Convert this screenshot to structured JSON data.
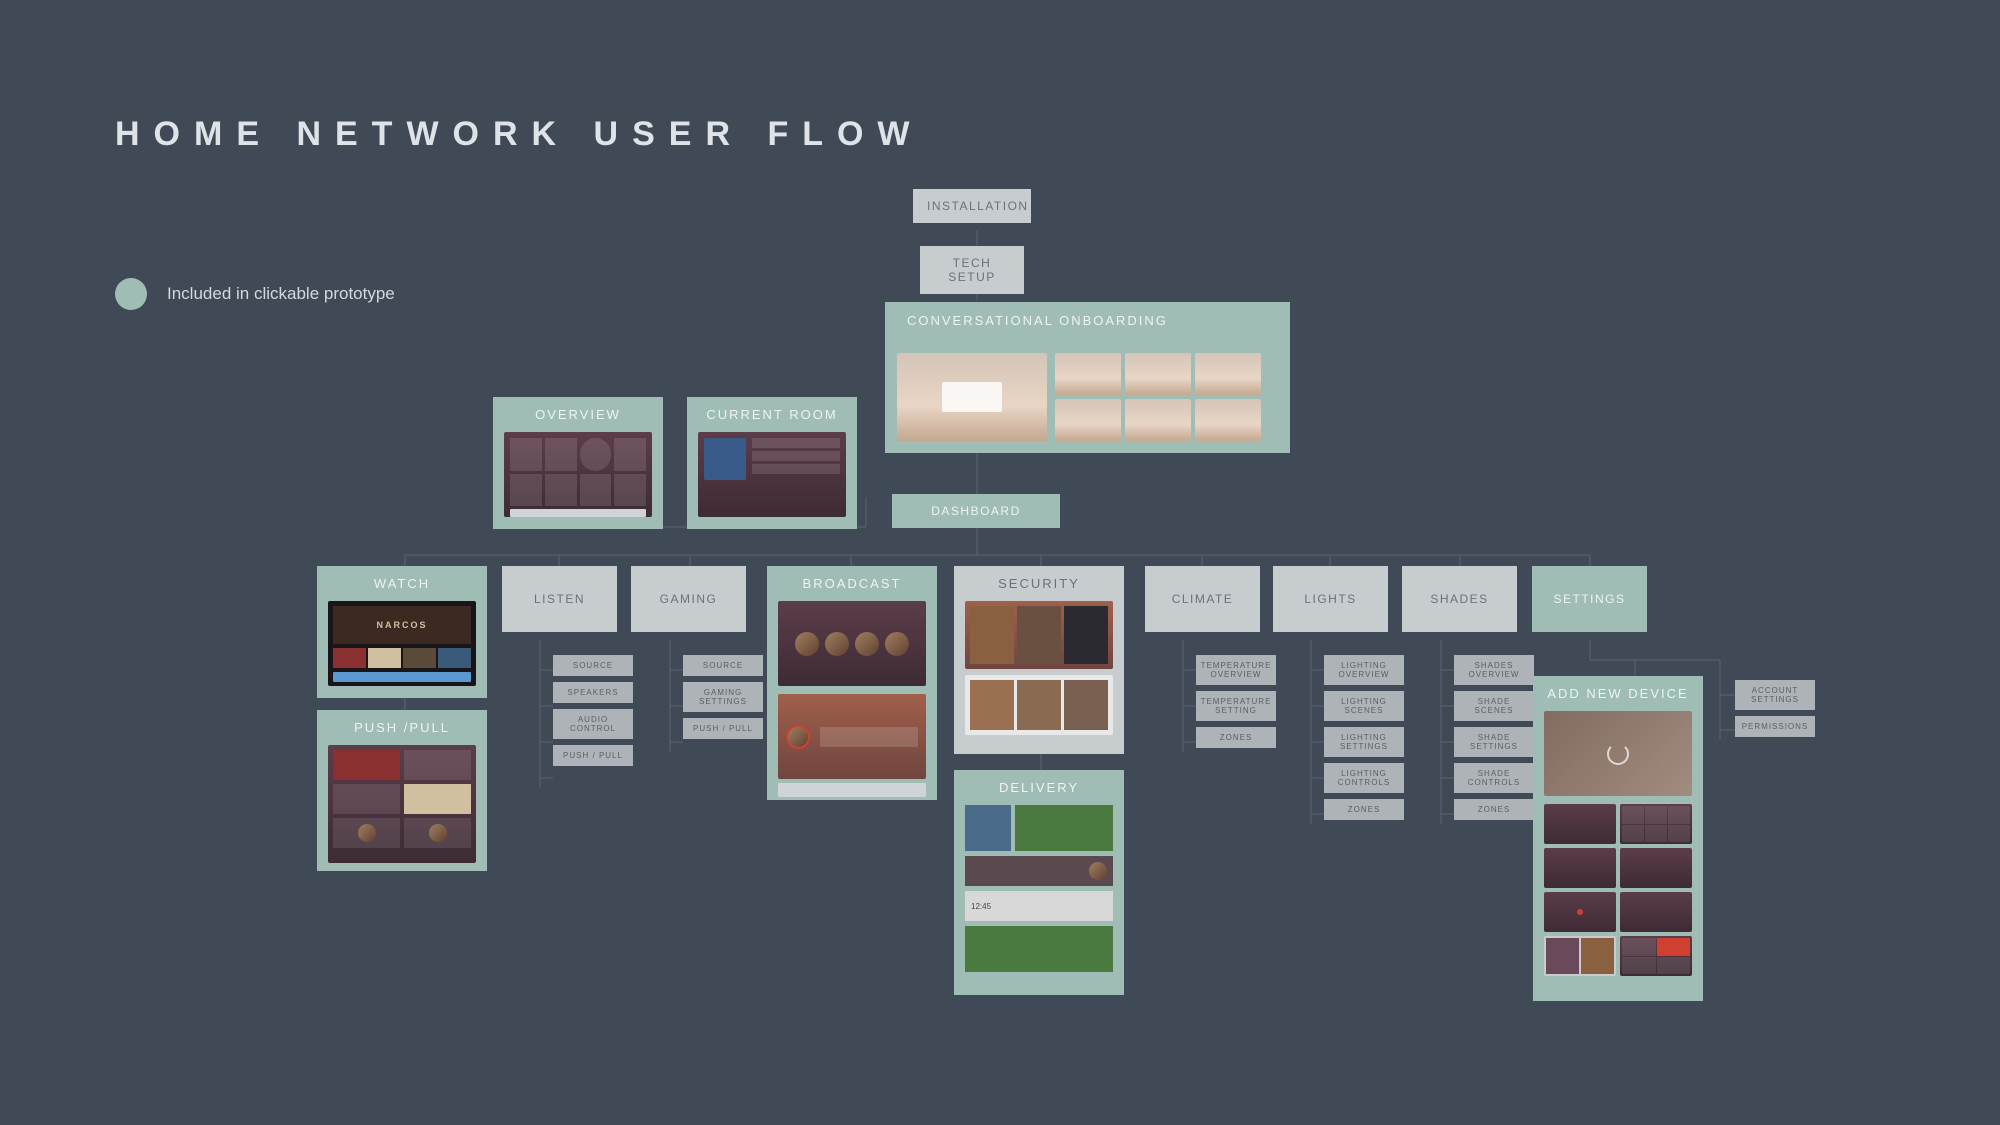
{
  "title": "HOME NETWORK USER FLOW",
  "legend": {
    "label": "Included in clickable prototype"
  },
  "nodes": {
    "installation": "INSTALLATION",
    "tech_setup": "TECH SETUP",
    "conversational": "CONVERSATIONAL ONBOARDING",
    "overview": "OVERVIEW",
    "current_room": "CURRENT ROOM",
    "dashboard": "DASHBOARD",
    "watch": "WATCH",
    "push_pull": "PUSH /PULL",
    "listen": "LISTEN",
    "gaming": "GAMING",
    "broadcast": "BROADCAST",
    "security": "SECURITY",
    "delivery": "DELIVERY",
    "climate": "CLIMATE",
    "lights": "LIGHTS",
    "shades": "SHADES",
    "settings": "SETTINGS",
    "add_new_device": "ADD NEW DEVICE"
  },
  "sub": {
    "listen": [
      "SOURCE",
      "SPEAKERS",
      "AUDIO CONTROL",
      "PUSH / PULL"
    ],
    "gaming": [
      "SOURCE",
      "GAMING SETTINGS",
      "PUSH / PULL"
    ],
    "climate": [
      "TEMPERATURE OVERVIEW",
      "TEMPERATURE SETTING",
      "ZONES"
    ],
    "lights": [
      "LIGHTING OVERVIEW",
      "LIGHTING SCENES",
      "LIGHTING SETTINGS",
      "LIGHTING CONTROLS",
      "ZONES"
    ],
    "shades": [
      "SHADES OVERVIEW",
      "SHADE SCENES",
      "SHADE SETTINGS",
      "SHADE CONTROLS",
      "ZONES"
    ],
    "settings_right": [
      "ACCOUNT SETTINGS",
      "PERMISSIONS"
    ]
  },
  "watch_card": {
    "brand": "NARCOS"
  }
}
